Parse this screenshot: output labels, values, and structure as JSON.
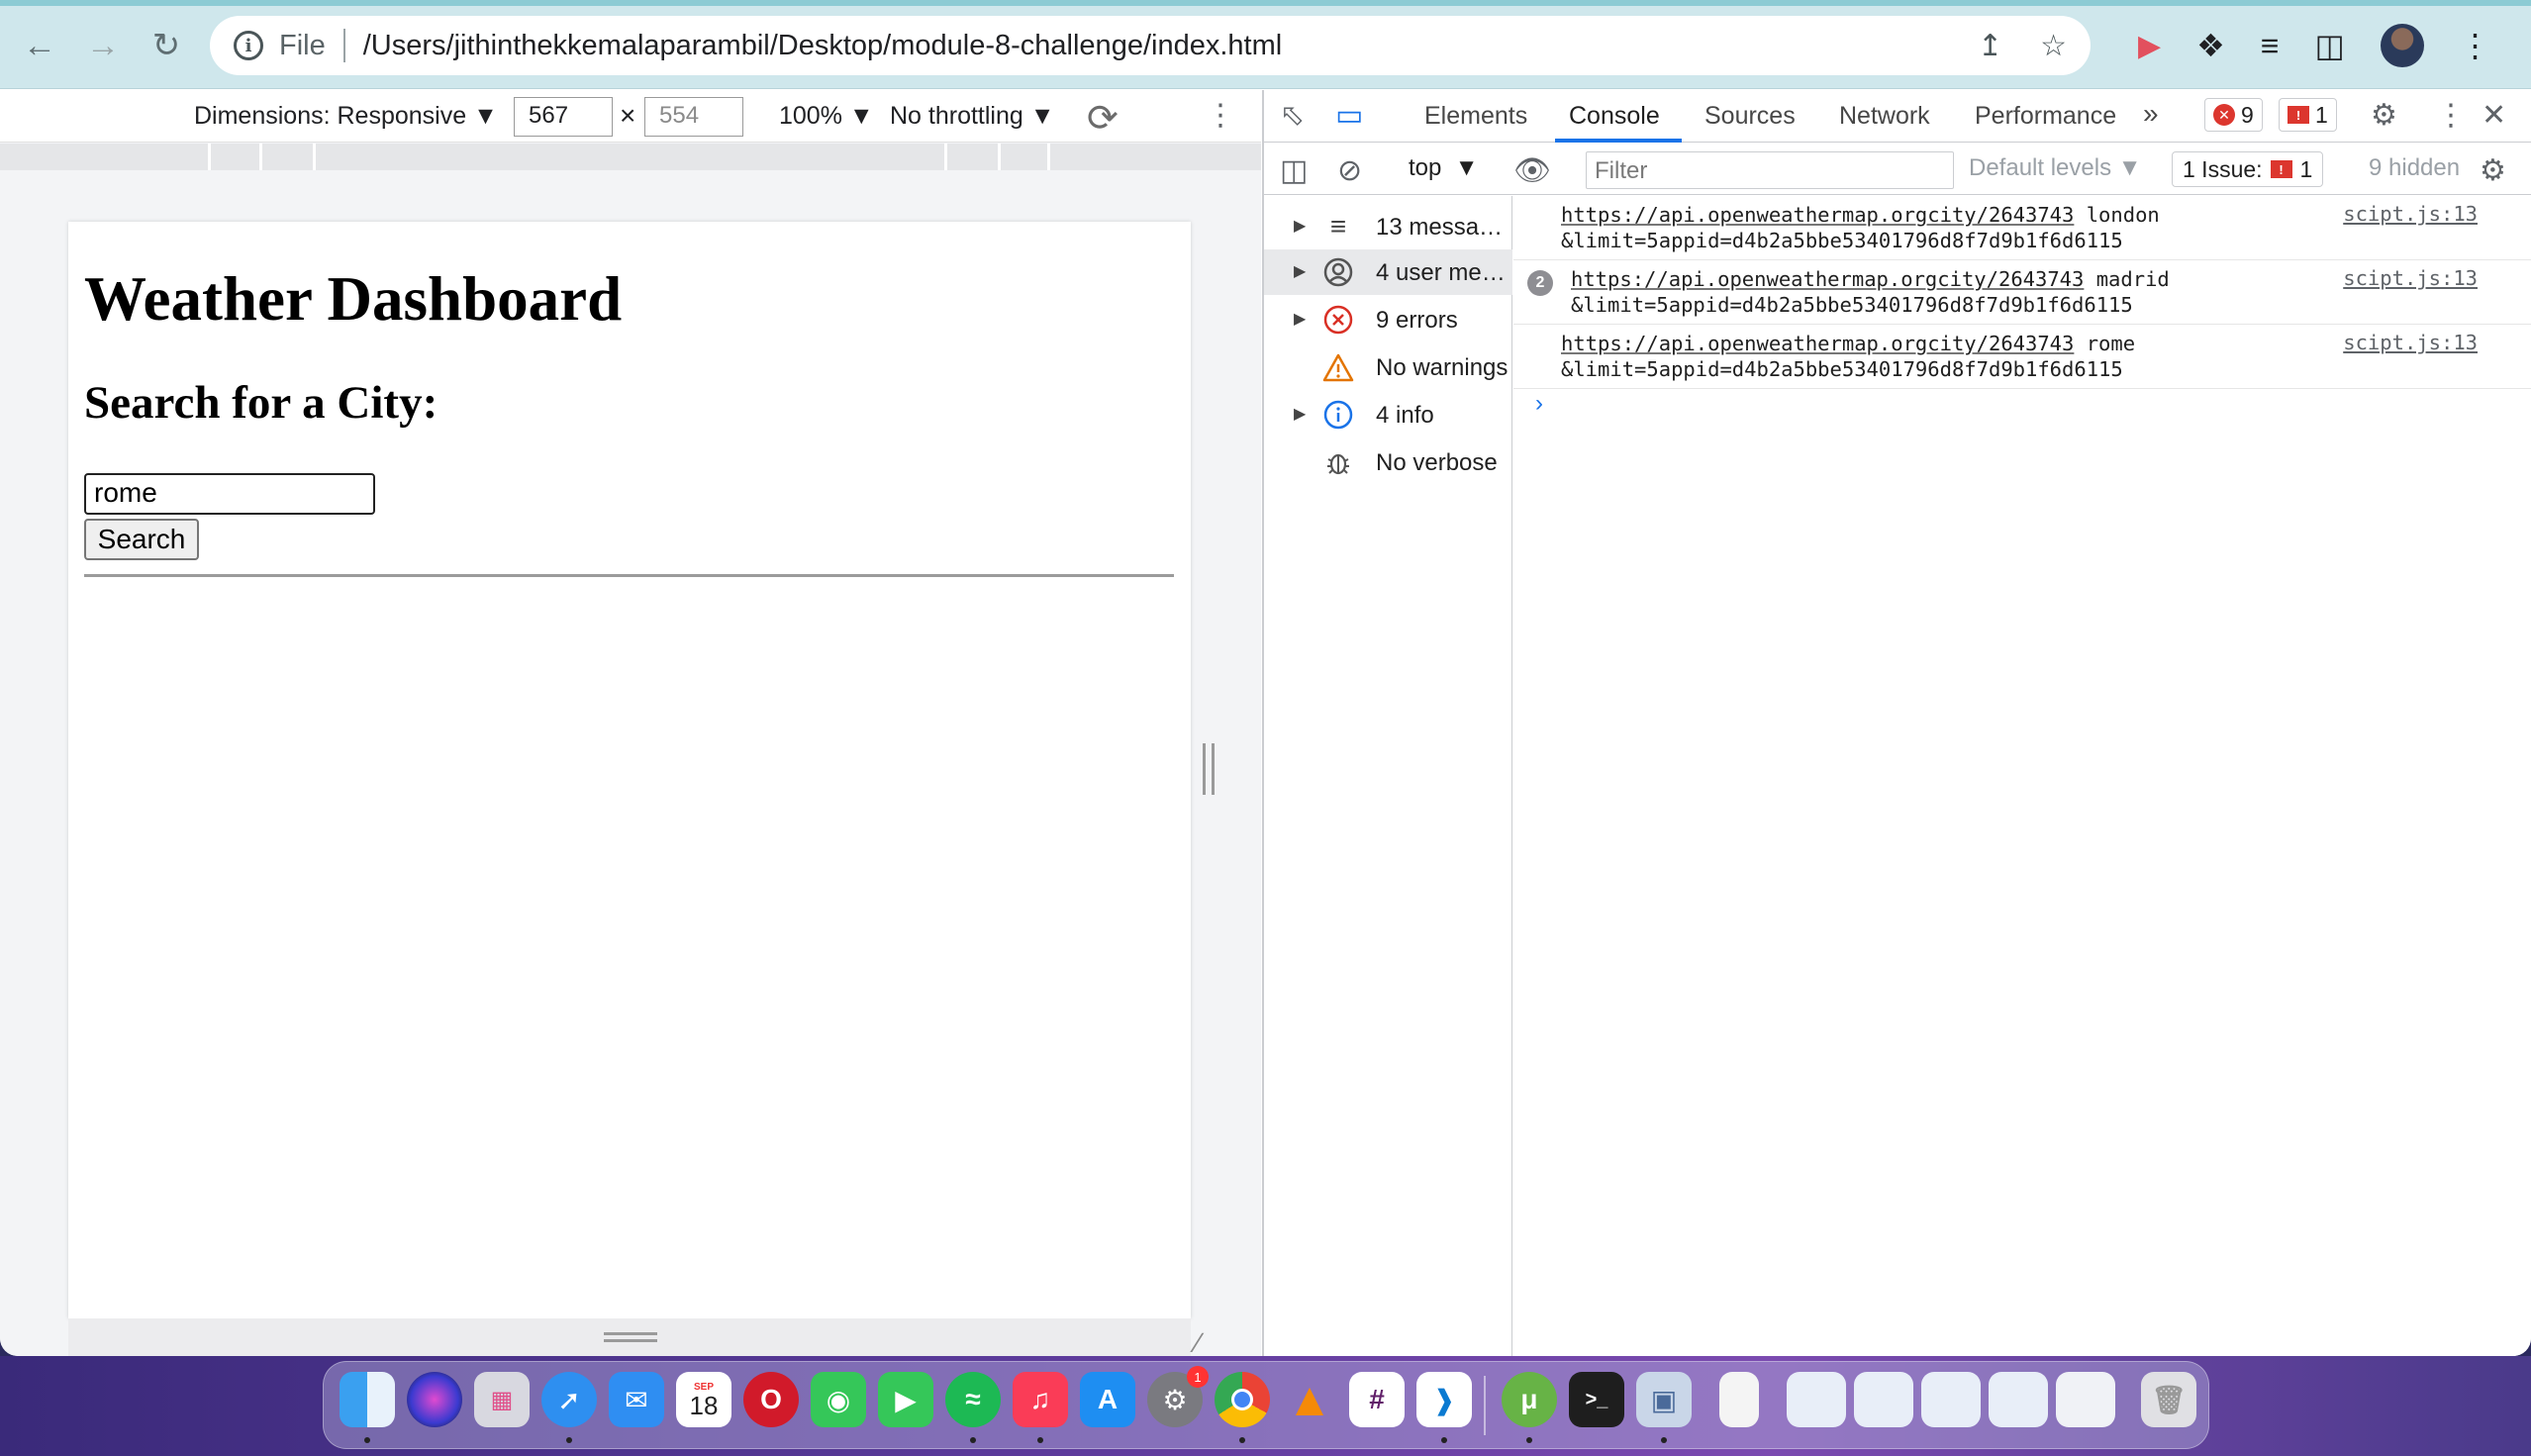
{
  "browser": {
    "address": {
      "scheme_label": "File",
      "url": "/Users/jithinthekkemalaparambil/Desktop/module-8-challenge/index.html"
    }
  },
  "device_toolbar": {
    "dimensions_label": "Dimensions: Responsive",
    "width": "567",
    "height_placeholder": "554",
    "times": "×",
    "zoom": "100%",
    "throttling": "No throttling"
  },
  "page": {
    "title": "Weather Dashboard",
    "subtitle": "Search for a City:",
    "search_value": "rome",
    "search_button": "Search"
  },
  "devtools": {
    "tabs": [
      "Elements",
      "Console",
      "Sources",
      "Network",
      "Performance"
    ],
    "active_tab": "Console",
    "more_tabs": "»",
    "error_count": "9",
    "issue_badge_count": "1",
    "console_bar": {
      "context": "top",
      "filter_placeholder": "Filter",
      "levels": "Default levels",
      "issues_label": "1 Issue:",
      "issues_count": "1",
      "hidden": "9 hidden"
    },
    "sidebar": [
      {
        "label": "13 messa…",
        "icon": "list-icon",
        "expandable": true
      },
      {
        "label": "4 user me…",
        "icon": "user-icon",
        "expandable": true,
        "selected": true
      },
      {
        "label": "9 errors",
        "icon": "error-icon",
        "expandable": true
      },
      {
        "label": "No warnings",
        "icon": "warning-icon",
        "expandable": false
      },
      {
        "label": "4 info",
        "icon": "info-icon",
        "expandable": true
      },
      {
        "label": "No verbose",
        "icon": "bug-icon",
        "expandable": false
      }
    ],
    "logs": [
      {
        "url": "https://api.openweathermap.orgcity/2643743",
        "city": " london",
        "cont": "&limit=5appid=d4b2a5bbe53401796d8f7d9b1f6d6115",
        "source": "scipt.js:13",
        "repeat": ""
      },
      {
        "url": "https://api.openweathermap.orgcity/2643743",
        "city": " madrid",
        "cont": "&limit=5appid=d4b2a5bbe53401796d8f7d9b1f6d6115",
        "source": "scipt.js:13",
        "repeat": "2"
      },
      {
        "url": "https://api.openweathermap.orgcity/2643743",
        "city": " rome",
        "cont": "&limit=5appid=d4b2a5bbe53401796d8f7d9b1f6d6115",
        "source": "scipt.js:13",
        "repeat": ""
      }
    ],
    "prompt": "›"
  },
  "dock": {
    "calendar_month": "SEP",
    "calendar_day": "18",
    "settings_badge": "1",
    "apps": [
      "finder",
      "siri",
      "launchpad",
      "safari",
      "mail",
      "calendar",
      "opera",
      "messages",
      "facetime",
      "spotify",
      "music",
      "app-store",
      "system-preferences",
      "chrome",
      "vlc",
      "slack",
      "vscode",
      "utorrent",
      "terminal",
      "preview"
    ]
  },
  "colors": {
    "accent": "#1a73e8",
    "error": "#dc362e",
    "toolbar": "#cfe7ec"
  }
}
